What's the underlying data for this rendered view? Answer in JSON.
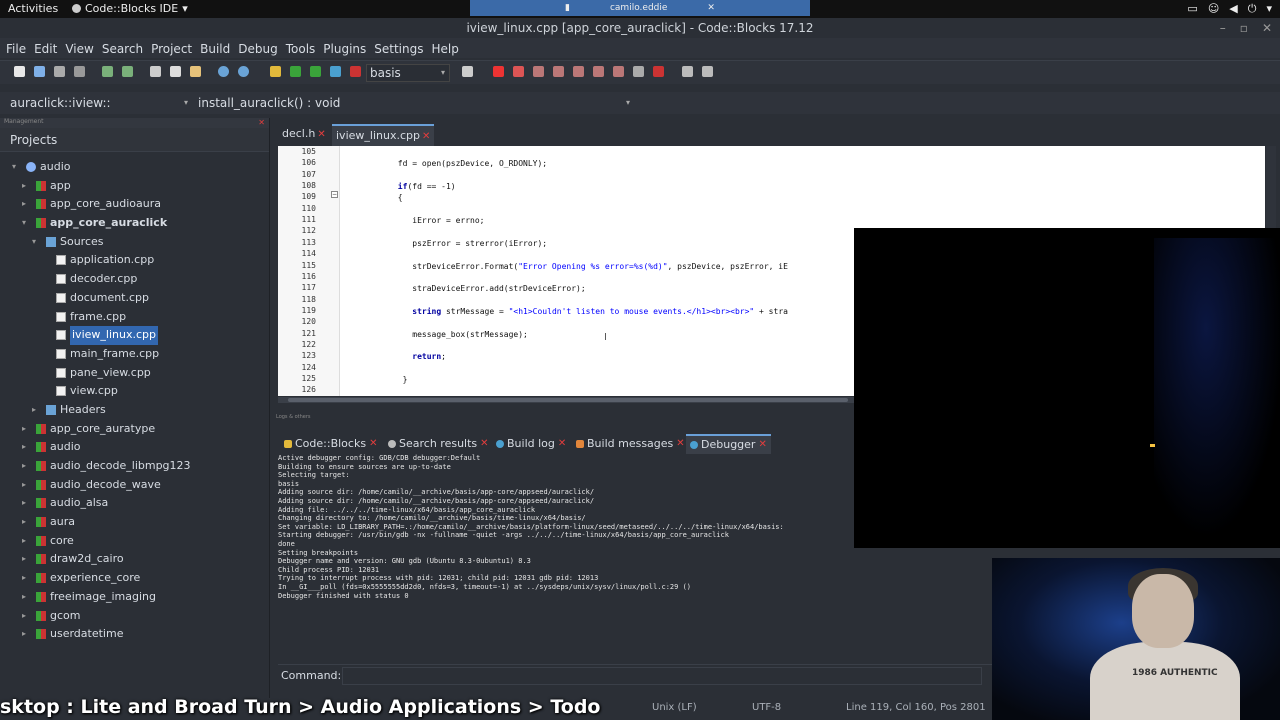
{
  "system_bar": {
    "activities": "Activities",
    "app_name": "Code::Blocks IDE",
    "center_text": "camilo.eddie"
  },
  "window": {
    "title": "iview_linux.cpp [app_core_auraclick] - Code::Blocks 17.12"
  },
  "menu": [
    "File",
    "Edit",
    "View",
    "Search",
    "Project",
    "Build",
    "Debug",
    "Tools",
    "Plugins",
    "Settings",
    "Help"
  ],
  "toolbar": {
    "build_target": "basis"
  },
  "scope": {
    "class": "auraclick::iview::",
    "function": "install_auraclick() : void"
  },
  "management": {
    "header": "Management",
    "tab": "Projects",
    "tree": [
      {
        "label": "audio",
        "level": 0,
        "type": "ws",
        "exp": "−"
      },
      {
        "label": "app",
        "level": 1,
        "type": "proj",
        "exp": "+"
      },
      {
        "label": "app_core_audioaura",
        "level": 1,
        "type": "proj",
        "exp": "+"
      },
      {
        "label": "app_core_auraclick",
        "level": 1,
        "type": "proj",
        "exp": "−",
        "bold": true
      },
      {
        "label": "Sources",
        "level": 2,
        "type": "folder",
        "exp": "−"
      },
      {
        "label": "application.cpp",
        "level": 3,
        "type": "file"
      },
      {
        "label": "decoder.cpp",
        "level": 3,
        "type": "file"
      },
      {
        "label": "document.cpp",
        "level": 3,
        "type": "file"
      },
      {
        "label": "frame.cpp",
        "level": 3,
        "type": "file"
      },
      {
        "label": "iview_linux.cpp",
        "level": 3,
        "type": "file",
        "selected": true
      },
      {
        "label": "main_frame.cpp",
        "level": 3,
        "type": "file"
      },
      {
        "label": "pane_view.cpp",
        "level": 3,
        "type": "file"
      },
      {
        "label": "view.cpp",
        "level": 3,
        "type": "file"
      },
      {
        "label": "Headers",
        "level": 2,
        "type": "folder",
        "exp": "+"
      },
      {
        "label": "app_core_auratype",
        "level": 1,
        "type": "proj",
        "exp": "+"
      },
      {
        "label": "audio",
        "level": 1,
        "type": "proj",
        "exp": "+"
      },
      {
        "label": "audio_decode_libmpg123",
        "level": 1,
        "type": "proj",
        "exp": "+"
      },
      {
        "label": "audio_decode_wave",
        "level": 1,
        "type": "proj",
        "exp": "+"
      },
      {
        "label": "audio_alsa",
        "level": 1,
        "type": "proj",
        "exp": "+"
      },
      {
        "label": "aura",
        "level": 1,
        "type": "proj",
        "exp": "+"
      },
      {
        "label": "core",
        "level": 1,
        "type": "proj",
        "exp": "+"
      },
      {
        "label": "draw2d_cairo",
        "level": 1,
        "type": "proj",
        "exp": "+"
      },
      {
        "label": "experience_core",
        "level": 1,
        "type": "proj",
        "exp": "+"
      },
      {
        "label": "freeimage_imaging",
        "level": 1,
        "type": "proj",
        "exp": "+"
      },
      {
        "label": "gcom",
        "level": 1,
        "type": "proj",
        "exp": "+"
      },
      {
        "label": "userdatetime",
        "level": 1,
        "type": "proj",
        "exp": "+"
      }
    ]
  },
  "editor_tabs": [
    {
      "label": "decl.h",
      "active": false
    },
    {
      "label": "iview_linux.cpp",
      "active": true
    }
  ],
  "editor": {
    "line_numbers": [
      "105",
      "106",
      "107",
      "108",
      "109",
      "110",
      "111",
      "112",
      "113",
      "114",
      "115",
      "116",
      "117",
      "118",
      "119",
      "120",
      "121",
      "122",
      "123",
      "124",
      "125",
      "126"
    ],
    "lines": [
      "",
      "            fd = open(pszDevice, O_RDONLY);",
      "",
      "            if(fd == -1)",
      "            {",
      "",
      "               iError = errno;",
      "",
      "               pszError = strerror(iError);",
      "",
      "               strDeviceError.Format(\"Error Opening %s error=%s(%d)\", pszDevice, pszError, iE",
      "",
      "               straDeviceError.add(strDeviceError);",
      "",
      "               string strMessage = \"<h1>Couldn't listen to mouse events.</h1><br><br>\" + stra",
      "",
      "               message_box(strMessage);",
      "",
      "               return;",
      "",
      "             }",
      ""
    ]
  },
  "logs": {
    "frame_label": "Logs & others",
    "tabs": [
      "Code::Blocks",
      "Search results",
      "Build log",
      "Build messages",
      "Debugger"
    ],
    "lines": [
      "Active debugger config: GDB/CDB debugger:Default",
      "Building to ensure sources are up-to-date",
      "Selecting target:",
      "basis",
      "Adding source dir: /home/camilo/__archive/basis/app-core/appseed/auraclick/",
      "Adding source dir: /home/camilo/__archive/basis/app-core/appseed/auraclick/",
      "Adding file: ../../../time-linux/x64/basis/app_core_auraclick",
      "Changing directory to: /home/camilo/__archive/basis/time-linux/x64/basis/",
      "Set variable: LD_LIBRARY_PATH=.:/home/camilo/__archive/basis/platform-linux/seed/metaseed/../../../time-linux/x64/basis:",
      "Starting debugger: /usr/bin/gdb -nx -fullname -quiet  -args ../../../time-linux/x64/basis/app_core_auraclick",
      "done",
      "Setting breakpoints",
      "Debugger name and version: GNU gdb (Ubuntu 8.3-0ubuntu1) 8.3",
      "Child process PID: 12031",
      "Trying to interrupt process with pid: 12031; child pid: 12031 gdb pid: 12013",
      "In __GI___poll (fds=0x5555555dd2d0, nfds=3, timeout=-1) at ../sysdeps/unix/sysv/linux/poll.c:29 ()",
      "Debugger finished with status 0"
    ],
    "command_label": "Command:"
  },
  "statusbar": {
    "eol": "Unix (LF)",
    "encoding": "UTF-8",
    "position": "Line 119, Col 160, Pos 2801"
  },
  "ticker": "sktop : Lite and Broad Turn > Audio Applications > Todo",
  "webcam": {
    "shirt_text": "1986 AUTHENTIC"
  }
}
